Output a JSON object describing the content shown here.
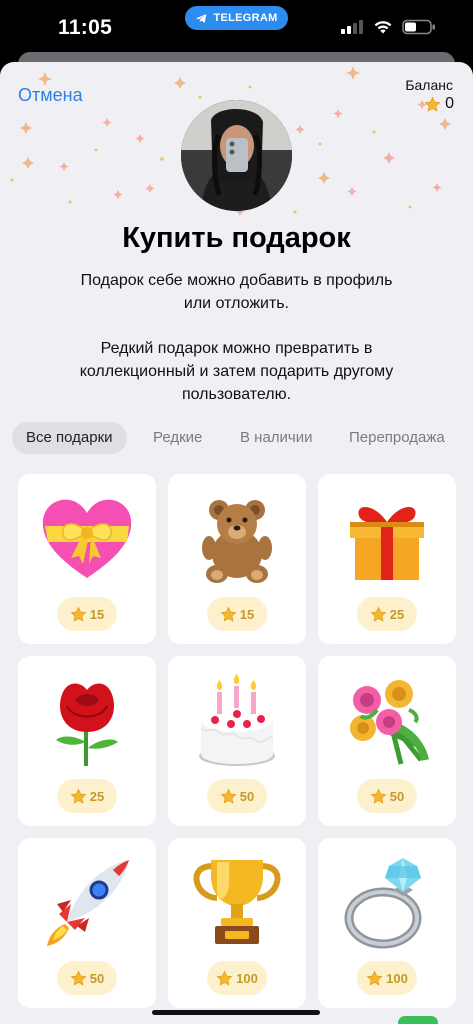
{
  "status_bar": {
    "time": "11:05",
    "app_pill": "TELEGRAM"
  },
  "header": {
    "cancel_label": "Отмена",
    "balance_label": "Баланс",
    "balance_value": "0"
  },
  "title": "Купить подарок",
  "description": [
    "Подарок себе можно добавить в профиль или отложить.",
    "Редкий подарок можно превратить в коллекционный и затем подарить другому пользователю."
  ],
  "tabs": [
    {
      "label": "Все подарки",
      "active": true
    },
    {
      "label": "Редкие",
      "active": false
    },
    {
      "label": "В наличии",
      "active": false
    },
    {
      "label": "Перепродажа",
      "active": false
    }
  ],
  "gifts": [
    {
      "icon": "heart-with-ribbon-icon",
      "price": "15"
    },
    {
      "icon": "teddy-bear-icon",
      "price": "15"
    },
    {
      "icon": "wrapped-gift-icon",
      "price": "25"
    },
    {
      "icon": "rose-icon",
      "price": "25"
    },
    {
      "icon": "birthday-cake-icon",
      "price": "50"
    },
    {
      "icon": "bouquet-icon",
      "price": "50"
    },
    {
      "icon": "rocket-icon",
      "price": "50"
    },
    {
      "icon": "trophy-icon",
      "price": "100"
    },
    {
      "icon": "ring-icon",
      "price": "100"
    }
  ],
  "colors": {
    "accent": "#2f80e0",
    "telegram": "#2c8cf0",
    "star": "#f5b82e",
    "price_bg": "#fdf0cc",
    "sheet_bg": "#efeff4"
  }
}
